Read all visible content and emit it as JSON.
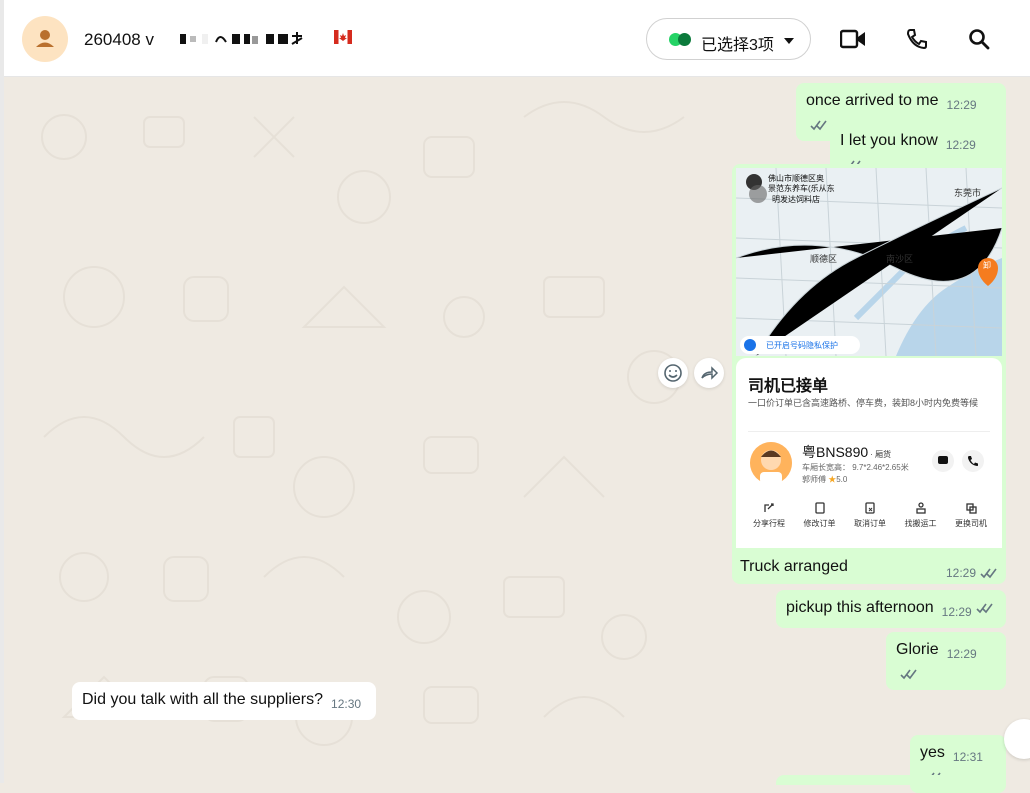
{
  "header": {
    "title": "260408 ᴠ",
    "select_label": "已选择3项"
  },
  "messages": {
    "m1": {
      "text": "once arrived to me",
      "time": "12:29"
    },
    "m2": {
      "text": "I let you know",
      "time": "12:29"
    },
    "m3": {
      "caption": "Truck arranged",
      "time": "12:29"
    },
    "m4": {
      "text": "pickup this afternoon",
      "time": "12:29"
    },
    "m5": {
      "text": "Glorie",
      "time": "12:29"
    },
    "m6": {
      "text": "Did you talk with all the suppliers?",
      "time": "12:30"
    },
    "m7": {
      "text": "yes",
      "time": "12:31"
    }
  },
  "map_labels": {
    "foshan": "佛山市顺德区奥",
    "foshan2": "景范东养车(乐从东",
    "foshan3": "明发达饲料店",
    "dongguan": "东莞市",
    "shunde": "顺德区",
    "nansha": "南沙区",
    "pin": "卸",
    "privacy": "已开启号码隐私保护"
  },
  "order": {
    "title": "司机已接单",
    "subtitle": "一口价订单已含高速路桥、停车费，装卸8小时内免费等候",
    "plate": "粤BNS890",
    "plate_tag": "· 厢货",
    "size": "车厢长宽高： 9.7*2.46*2.65米",
    "driver": "郭师傅",
    "rating": "5.0",
    "actions": [
      "分享行程",
      "修改订单",
      "取消订单",
      "找搬运工",
      "更换司机"
    ]
  },
  "colors": {
    "out_bubble": "#d9fdd3",
    "in_bubble": "#ffffff",
    "chat_bg": "#efeae2",
    "accent_green": "#25d366"
  }
}
